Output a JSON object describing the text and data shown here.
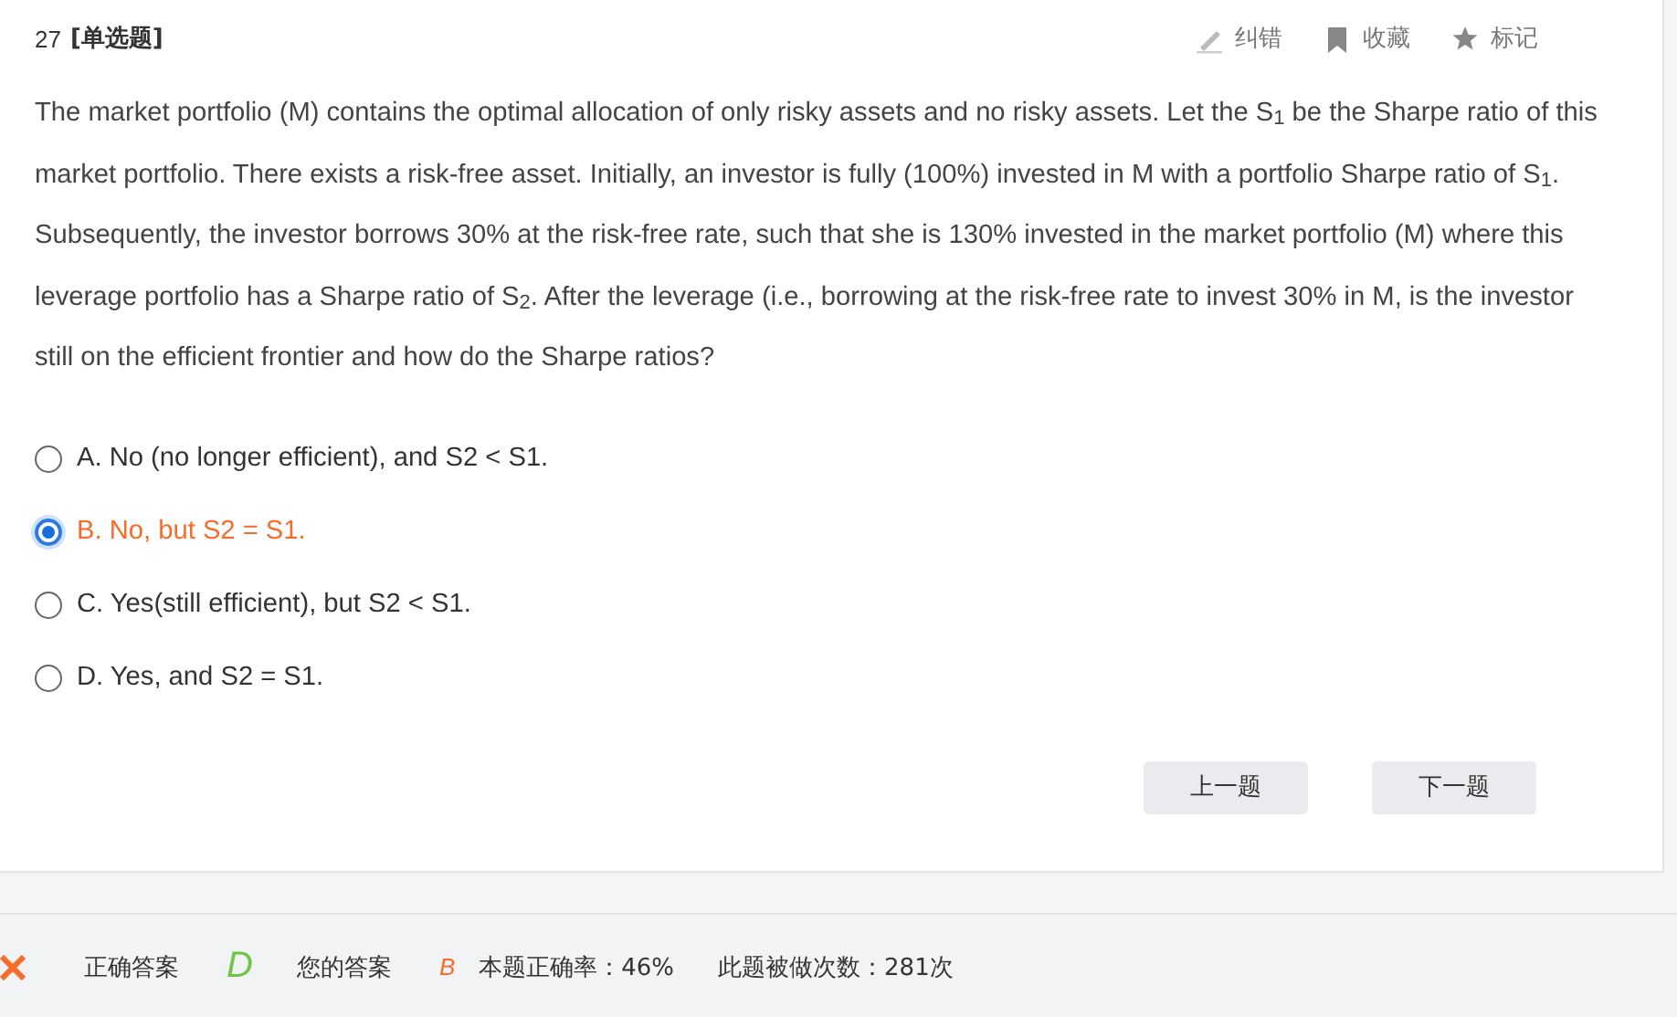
{
  "question": {
    "number": "27",
    "type": "[单选题]",
    "actions": [
      {
        "kind": "correct",
        "label": "纠错"
      },
      {
        "kind": "bookmark",
        "label": "收藏"
      },
      {
        "kind": "mark",
        "label": "标记"
      }
    ],
    "text": "The market portfolio (M) contains the optimal allocation of only risky assets and no risky assets. Let the S$_{1}$ be the Sharpe ratio of this market portfolio. There exists a risk-free asset. Initially, an investor is fully (100%) invested in M with a portfolio Sharpe ratio of S$_{1}$. Subsequently, the investor borrows 30% at the risk-free rate, such that she is 130% invested in the market portfolio (M) where this leverage portfolio has a Sharpe ratio of S$_{2}$. After the leverage (i.e., borrowing at the risk-free rate to invest 30% in M, is the investor still on the efficient frontier and how do the Sharpe ratios?",
    "options": [
      {
        "label": "A. No (no longer efficient), and S2 < S1.",
        "selected": false
      },
      {
        "label": "B. No, but S2 = S1.",
        "selected": true
      },
      {
        "label": "C. Yes(still efficient), but S2 < S1.",
        "selected": false
      },
      {
        "label": "D. Yes, and S2 = S1.",
        "selected": false
      }
    ],
    "buttons": [
      "上一题",
      "下一题"
    ]
  },
  "result": {
    "correct": false,
    "correct_answer_label": "正确答案",
    "correct_answer": "D",
    "your_answer_label": "您的答案",
    "your_answer": "B",
    "accuracy": "本题正确率：46%",
    "attempts": "此题被做次数：281次"
  }
}
